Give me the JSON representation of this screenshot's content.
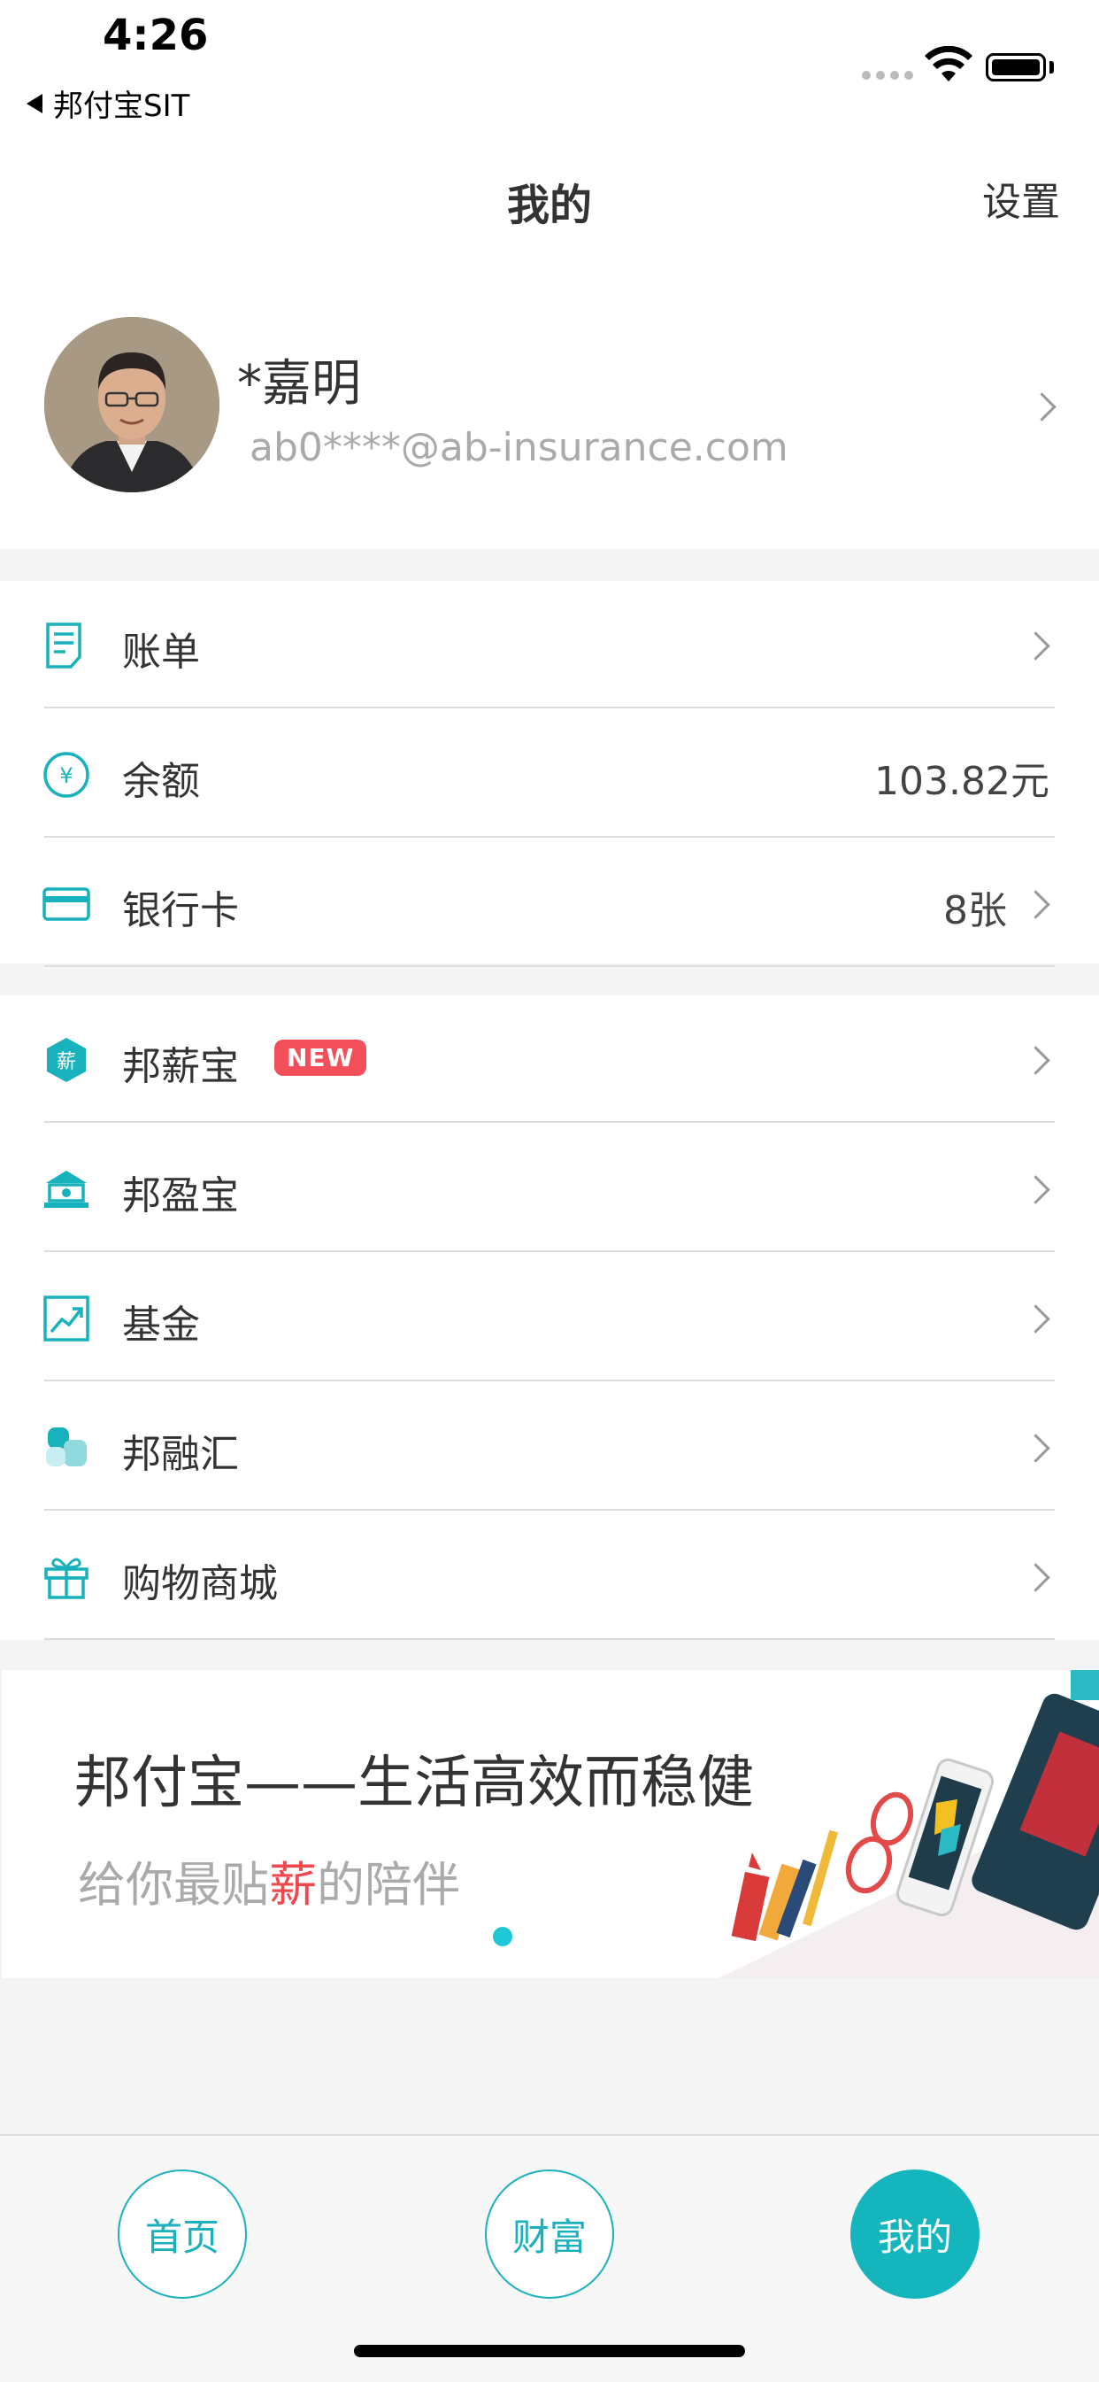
{
  "status": {
    "time": "4:26",
    "back_app": "邦付宝SIT"
  },
  "nav": {
    "title": "我的",
    "settings": "设置"
  },
  "profile": {
    "name": "*嘉明",
    "email": "ab0****@ab-insurance.com"
  },
  "account_rows": [
    {
      "label": "账单",
      "value": "",
      "icon": "bill-icon"
    },
    {
      "label": "余额",
      "value": "103.82元",
      "icon": "yuan-icon"
    },
    {
      "label": "银行卡",
      "value": "8张",
      "icon": "bank-card-icon"
    }
  ],
  "product_rows": [
    {
      "label": "邦薪宝",
      "badge": "NEW",
      "icon": "salary-icon"
    },
    {
      "label": "邦盈宝",
      "icon": "bank-building-icon"
    },
    {
      "label": "基金",
      "icon": "trend-chart-icon"
    },
    {
      "label": "邦融汇",
      "icon": "blocks-icon"
    },
    {
      "label": "购物商城",
      "icon": "gift-icon"
    }
  ],
  "banner": {
    "title": "邦付宝——生活高效而稳健",
    "sub_before": "给你最贴",
    "sub_highlight": "薪",
    "sub_after": "的陪伴"
  },
  "tabs": {
    "home": "首页",
    "wealth": "财富",
    "mine": "我的"
  },
  "colors": {
    "accent": "#15b5bd",
    "badge": "#f24f5a",
    "highlight": "#f0494d"
  }
}
